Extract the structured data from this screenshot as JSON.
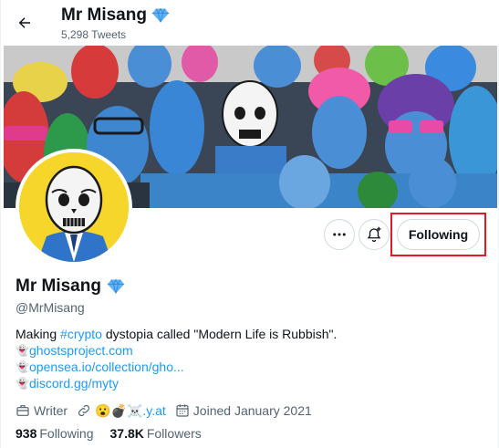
{
  "header": {
    "title": "Mr Misang",
    "tweet_count": "5,298 Tweets"
  },
  "profile": {
    "name": "Mr Misang",
    "handle": "@MrMisang",
    "verified_icon": "diamond-icon",
    "follow_button_label": "Following",
    "bio": {
      "prefix": "Making ",
      "hashtag": "#crypto",
      "suffix": " dystopia called \"Modern Life is Rubbish\".",
      "links": [
        "ghostsproject.com",
        "opensea.io/collection/gho...",
        "discord.gg/myty"
      ]
    },
    "meta": {
      "profession": "Writer",
      "website_emojis": "😮💣☠️",
      "website_text": ".y.at",
      "joined": "Joined January 2021"
    },
    "following_count": "938",
    "following_label": "Following",
    "followers_count": "37.8K",
    "followers_label": "Followers"
  },
  "colors": {
    "accent": "#1d9bf0",
    "highlight_box": "#e01b24",
    "verified": "#5fb3f5"
  }
}
